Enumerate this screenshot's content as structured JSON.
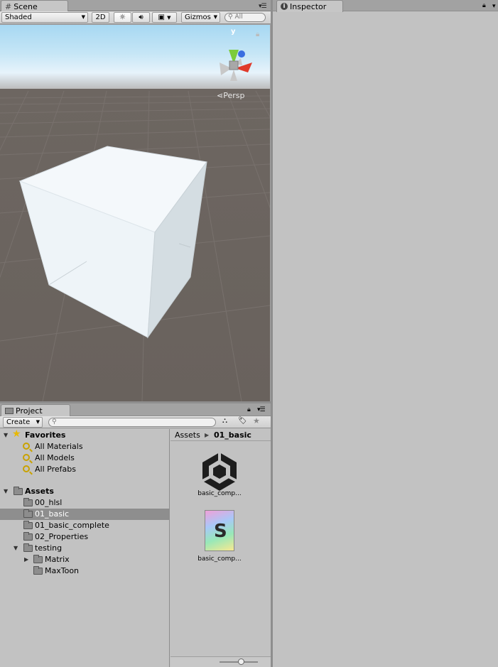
{
  "scene": {
    "tab_label": "Scene",
    "shading_mode": "Shaded",
    "mode_2d": "2D",
    "gizmos_label": "Gizmos",
    "search_placeholder": "All",
    "projection_label": "Persp",
    "gizmo_axis_label": "y"
  },
  "inspector": {
    "tab_label": "Inspector"
  },
  "project": {
    "tab_label": "Project",
    "create_label": "Create",
    "favorites": {
      "header": "Favorites",
      "items": [
        "All Materials",
        "All Models",
        "All Prefabs"
      ]
    },
    "assets": {
      "header": "Assets",
      "folders": [
        "00_hlsl",
        "01_basic",
        "01_basic_complete",
        "02_Properties",
        "testing"
      ],
      "testing_children": [
        "Matrix",
        "MaxToon"
      ],
      "selected": "01_basic"
    },
    "breadcrumb": {
      "root": "Assets",
      "current": "01_basic"
    },
    "files": [
      {
        "name": "basic_comp...",
        "icon": "unity-logo-icon"
      },
      {
        "name": "basic_comp...",
        "icon": "shader-file-icon"
      }
    ],
    "zoom_level": 0.55
  },
  "colors": {
    "panel_bg": "#c2c2c2",
    "selection": "#8e8e8e",
    "sky": "#c6e6f6",
    "ground": "#6b645f",
    "gizmo_x": "#e03a2a",
    "gizmo_y": "#7ccc3a",
    "gizmo_z": "#3a6ee0"
  }
}
